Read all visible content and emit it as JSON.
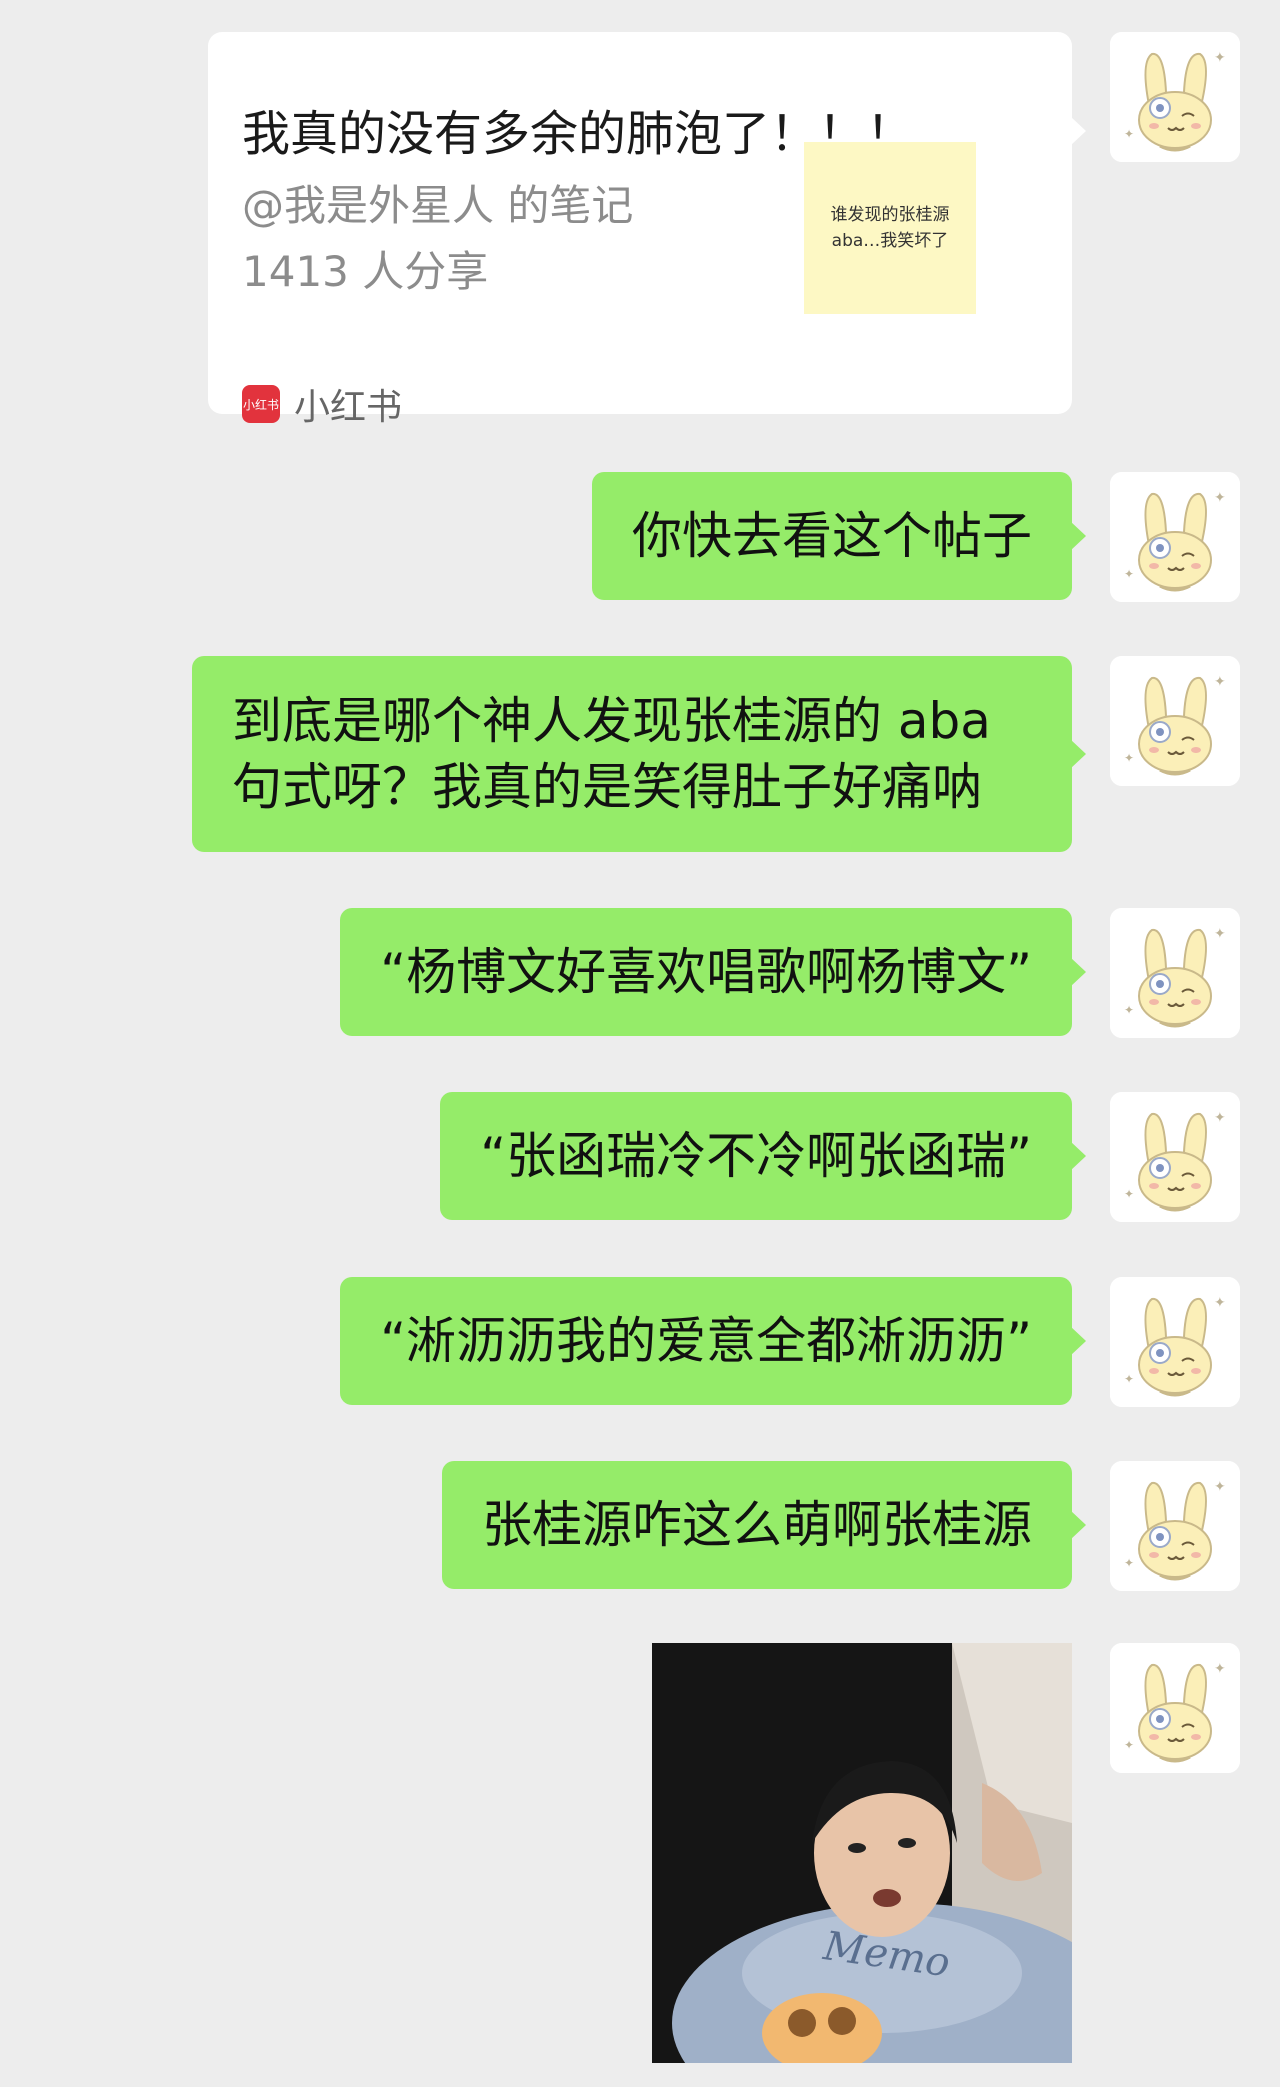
{
  "colors": {
    "background": "#ededed",
    "sent_bubble": "#95ec69",
    "card_bg": "#ffffff",
    "xhs_red": "#e2333d"
  },
  "avatar": {
    "icon": "bunny-avatar-icon"
  },
  "shared_card": {
    "title": "我真的没有多余的肺泡了！！！",
    "author": "@我是外星人 的笔记",
    "shares": "1413 人分享",
    "thumbnail_line1": "谁发现的张桂源",
    "thumbnail_line2": "aba…我笑坏了",
    "app_logo_text": "小红书",
    "app_name": "小红书"
  },
  "messages": [
    {
      "text": "你快去看这个帖子"
    },
    {
      "text": "到底是哪个神人发现张桂源的 aba 句式呀？我真的是笑得肚子好痛呐"
    },
    {
      "text": "“杨博文好喜欢唱歌啊杨博文”"
    },
    {
      "text": "“张函瑞冷不冷啊张函瑞”"
    },
    {
      "text": "“淅沥沥我的爱意全都淅沥沥”"
    },
    {
      "text": "张桂源咋这么萌啊张桂源"
    }
  ],
  "photo": {
    "shirt_text": "Memo"
  }
}
